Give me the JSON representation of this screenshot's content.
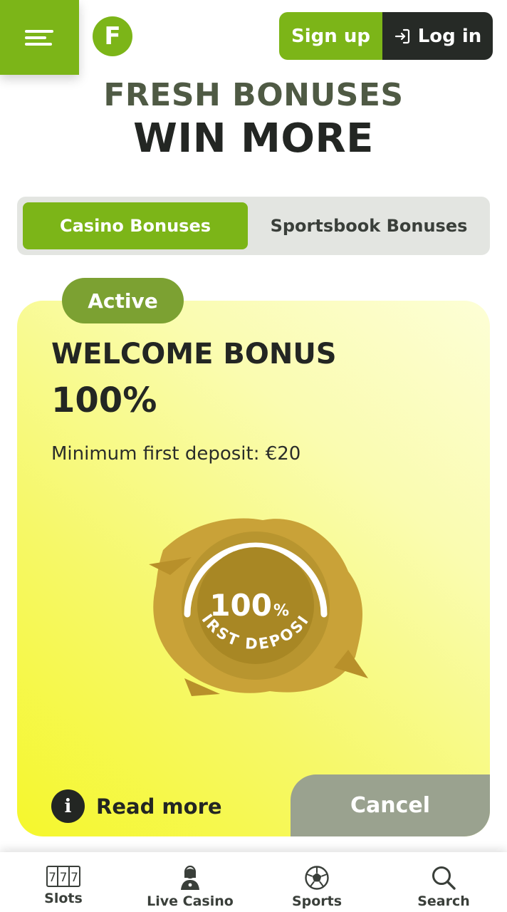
{
  "header": {
    "menu_icon": "menu-icon",
    "logo_letter": "F",
    "signup_label": "Sign up",
    "login_label": "Log in",
    "login_icon": "login-arrow-icon"
  },
  "hero": {
    "line1": "FRESH BONUSES",
    "line2": "WIN MORE"
  },
  "tabs": [
    {
      "label": "Casino Bonuses",
      "active": true
    },
    {
      "label": "Sportsbook Bonuses",
      "active": false
    }
  ],
  "bonus_card": {
    "status": "Active",
    "title": "WELCOME BONUS",
    "percent": "100%",
    "minimum": "Minimum first deposit: €20",
    "badge_value": "100",
    "badge_unit": "%",
    "badge_caption": "FIRST DEPOSIT",
    "read_more_label": "Read more",
    "cancel_label": "Cancel"
  },
  "bottom_nav": [
    {
      "label": "Slots",
      "icon": "slots-777-icon"
    },
    {
      "label": "Live Casino",
      "icon": "live-dealer-icon"
    },
    {
      "label": "Sports",
      "icon": "soccer-ball-icon"
    },
    {
      "label": "Search",
      "icon": "search-icon"
    }
  ],
  "colors": {
    "brand_green": "#7cb518",
    "dark": "#262a26",
    "cancel_grey": "#9aa28f"
  }
}
